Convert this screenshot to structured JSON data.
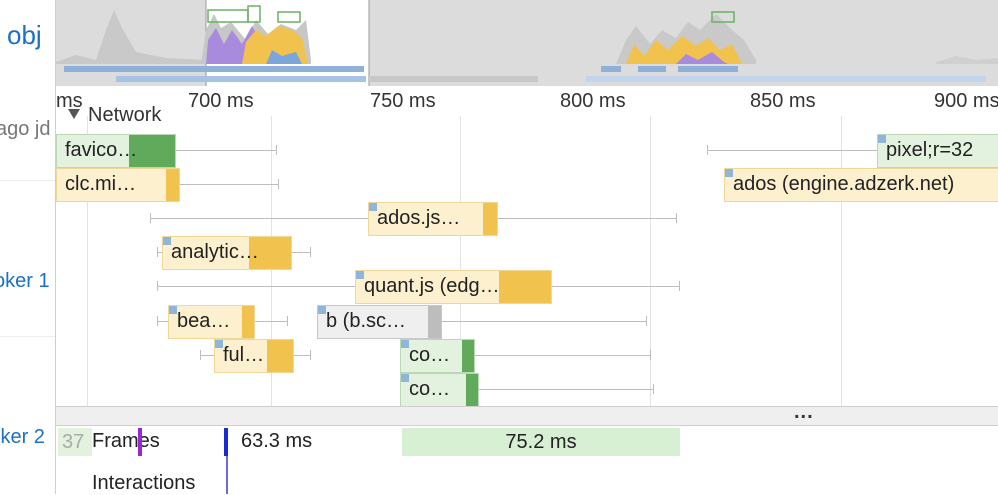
{
  "left_panel": {
    "texts": [
      "obj",
      "ago jd",
      "oker 1",
      "lker 2"
    ]
  },
  "ruler": {
    "ticks": [
      {
        "label": "ms",
        "ms": 650
      },
      {
        "label": "700 ms",
        "ms": 700
      },
      {
        "label": "750 ms",
        "ms": 750
      },
      {
        "label": "800 ms",
        "ms": 800
      },
      {
        "label": "850 ms",
        "ms": 850
      },
      {
        "label": "900 ms",
        "ms": 900
      }
    ]
  },
  "network": {
    "title": "Network",
    "toggle_icon": "triangle-down-icon",
    "requests": [
      {
        "label": "favico…",
        "type": "image"
      },
      {
        "label": "pixel;r=32",
        "type": "image"
      },
      {
        "label": "clc.mi…",
        "type": "script"
      },
      {
        "label": "ados (engine.adzerk.net)",
        "type": "script"
      },
      {
        "label": "ados.js…",
        "type": "script"
      },
      {
        "label": "analytic…",
        "type": "script"
      },
      {
        "label": "quant.js (edg…",
        "type": "script"
      },
      {
        "label": "bea…",
        "type": "script"
      },
      {
        "label": "b (b.sc…",
        "type": "other"
      },
      {
        "label": "ful…",
        "type": "script"
      },
      {
        "label": "co…",
        "type": "image"
      },
      {
        "label": "co…",
        "type": "image"
      }
    ]
  },
  "splitter": {
    "label": "..."
  },
  "frames": {
    "title": "Frames",
    "partial": "37",
    "durations": [
      "63.3 ms",
      "75.2 ms"
    ]
  },
  "interactions": {
    "title": "Interactions"
  },
  "colors": {
    "script_fill": "#fdf0cf",
    "script_tail": "#f2c24f",
    "image_fill": "#e3f1df",
    "image_tail": "#62aa5b",
    "other_fill": "#efefef",
    "other_tail": "#bdbdbd",
    "frame_green": "#d7efd2",
    "overview_bg": "#e9e9e9",
    "link_blue": "#1b71c5"
  }
}
